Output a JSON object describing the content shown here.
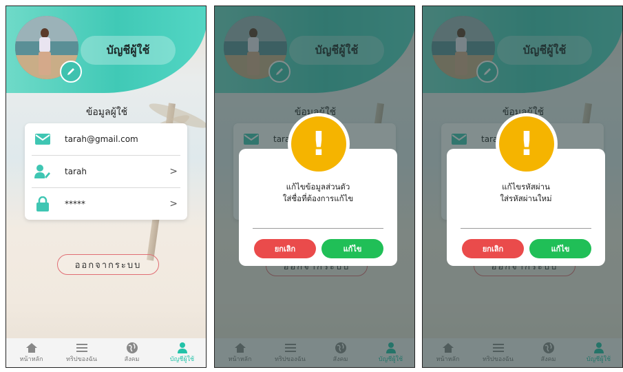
{
  "header": {
    "title": "บัญชีผู้ใช้"
  },
  "profile": {
    "section_title": "ข้อมูลผู้ใช้",
    "email": "tarah@gmail.com",
    "username": "tarah",
    "password": "*****",
    "chevron": ">"
  },
  "logout_label": "ออกจากระบบ",
  "nav": {
    "home": "หน้าหลัก",
    "trips": "ทริปของฉัน",
    "social": "สังคม",
    "account": "บัญชีผู้ใช้"
  },
  "dialog_name": {
    "line1": "แก้ไขข้อมูลส่วนตัว",
    "line2": "ใส่ชื่อที่ต้องการแก้ไข",
    "cancel": "ยกเลิก",
    "confirm": "แก้ไข",
    "input_value": ""
  },
  "dialog_password": {
    "line1": "แก้ไขรหัสผ่าน",
    "line2": "ใส่รหัสผ่านใหม่",
    "cancel": "ยกเลิก",
    "confirm": "แก้ไข",
    "input_value": ""
  },
  "warning_mark": "!",
  "colors": {
    "accent": "#40c9b6",
    "nav_active": "#22c2a8",
    "cancel": "#ea4b4b",
    "confirm": "#20bf57",
    "warning": "#f5b400"
  },
  "icons": [
    "pencil-icon",
    "mail-icon",
    "user-edit-icon",
    "lock-icon",
    "chevron-right-icon",
    "home-icon",
    "list-icon",
    "globe-icon",
    "person-icon",
    "warning-icon"
  ]
}
